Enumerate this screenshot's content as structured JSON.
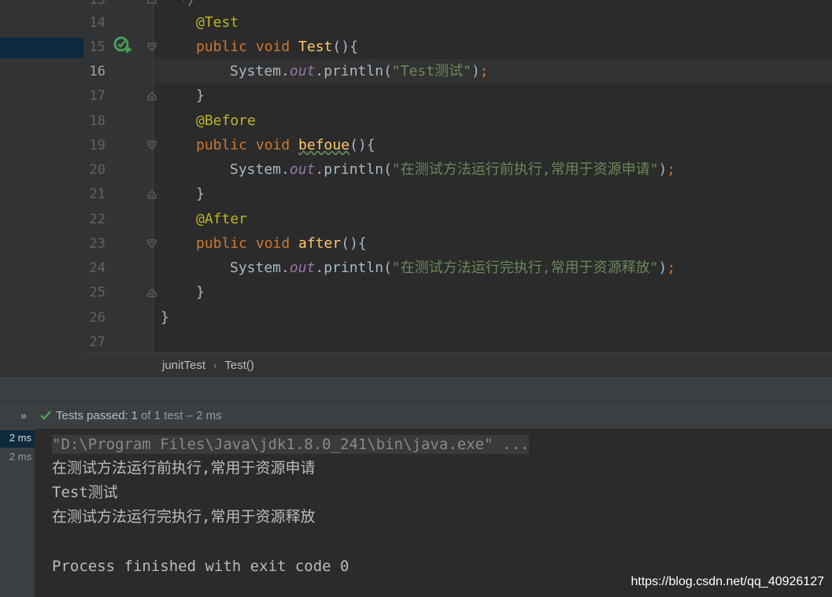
{
  "editor": {
    "line_numbers": [
      "14",
      "15",
      "16",
      "17",
      "18",
      "19",
      "20",
      "21",
      "22",
      "23",
      "24",
      "25",
      "26",
      "27"
    ],
    "current_line": "16",
    "lines": {
      "l14": {
        "ann": "@Test"
      },
      "l15": {
        "kw": "public void ",
        "fn": "Test",
        "rest": "(){"
      },
      "l16": {
        "pre": "System.",
        "fld": "out",
        "mid": ".println(",
        "str": "\"Test测试\"",
        "close": ")",
        "semi": ";"
      },
      "l17": {
        "brace": "}"
      },
      "l18": {
        "ann": "@Before"
      },
      "l19": {
        "kw": "public void ",
        "fn": "befoue",
        "rest": "(){"
      },
      "l20": {
        "pre": "System.",
        "fld": "out",
        "mid": ".println(",
        "str": "\"在测试方法运行前执行,常用于资源申请\"",
        "close": ")",
        "semi": ";"
      },
      "l21": {
        "brace": "}"
      },
      "l22": {
        "ann": "@After"
      },
      "l23": {
        "kw": "public void ",
        "fn": "after",
        "rest": "(){"
      },
      "l24": {
        "pre": "System.",
        "fld": "out",
        "mid": ".println(",
        "str": "\"在测试方法运行完执行,常用于资源释放\"",
        "close": ")",
        "semi": ";"
      },
      "l25": {
        "brace": "}"
      },
      "l26": {
        "brace": "}"
      }
    }
  },
  "breadcrumb": {
    "items": [
      "junitTest",
      "Test()"
    ]
  },
  "test_status": {
    "label": "Tests passed:",
    "count": "1",
    "rest": "of 1 test – 2 ms"
  },
  "durations": [
    "2 ms",
    "2 ms"
  ],
  "console": {
    "command": "\"D:\\Program Files\\Java\\jdk1.8.0_241\\bin\\java.exe\" ...",
    "output": [
      "在测试方法运行前执行,常用于资源申请",
      "Test测试",
      "在测试方法运行完执行,常用于资源释放"
    ],
    "exit": "Process finished with exit code 0"
  },
  "watermark": "https://blog.csdn.net/qq_40926127",
  "colors": {
    "keyword": "#cc7832",
    "annotation": "#bbb529",
    "method": "#ffc66d",
    "string": "#6a8759",
    "field": "#9876aa",
    "pass": "#499c54"
  }
}
